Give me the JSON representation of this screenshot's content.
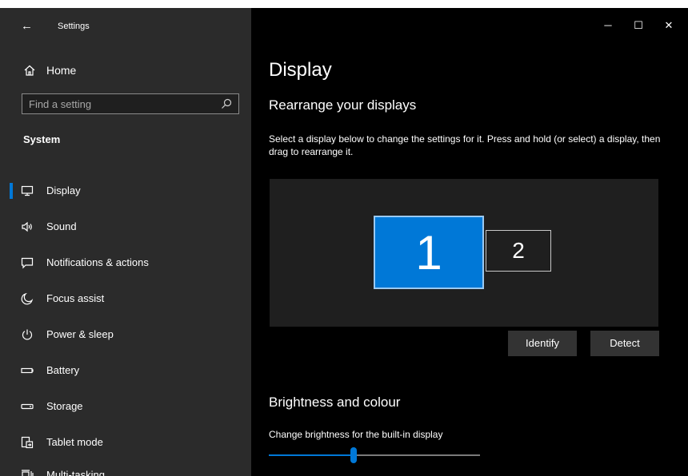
{
  "window": {
    "title": "Settings",
    "back_glyph": "←",
    "controls": {
      "minimize": "─",
      "maximize": "☐",
      "close": "✕"
    }
  },
  "sidebar": {
    "home_label": "Home",
    "search_placeholder": "Find a setting",
    "section_title": "System",
    "items": [
      {
        "label": "Display",
        "icon": "display-icon",
        "selected": true
      },
      {
        "label": "Sound",
        "icon": "sound-icon"
      },
      {
        "label": "Notifications & actions",
        "icon": "notifications-icon"
      },
      {
        "label": "Focus assist",
        "icon": "moon-icon"
      },
      {
        "label": "Power & sleep",
        "icon": "power-icon"
      },
      {
        "label": "Battery",
        "icon": "battery-icon"
      },
      {
        "label": "Storage",
        "icon": "storage-icon"
      },
      {
        "label": "Tablet mode",
        "icon": "tablet-mode-icon"
      },
      {
        "label": "Multi-tasking",
        "icon": "multitasking-icon"
      }
    ]
  },
  "main": {
    "title": "Display",
    "rearrange_heading": "Rearrange your displays",
    "rearrange_description": "Select a display below to change the settings for it. Press and hold (or select) a display, then drag to rearrange it.",
    "monitors": [
      {
        "number": "1",
        "selected": true
      },
      {
        "number": "2",
        "selected": false
      }
    ],
    "identify_label": "Identify",
    "detect_label": "Detect",
    "brightness_heading": "Brightness and colour",
    "brightness_label": "Change brightness for the built-in display",
    "brightness_value": 0.4
  },
  "colors": {
    "accent": "#0078d7",
    "sidebar_bg": "#2b2b2b",
    "content_bg": "#000000",
    "panel_bg": "#1f1f1f"
  }
}
